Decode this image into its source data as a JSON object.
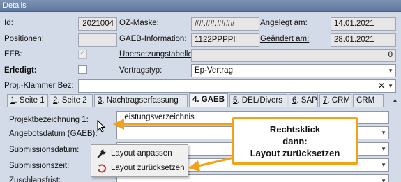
{
  "window": {
    "title": "Details"
  },
  "fields": {
    "id": {
      "label": "Id:",
      "value": "2021004"
    },
    "oz_maske": {
      "label": "OZ-Maske:",
      "value": "##.##.####"
    },
    "angelegt": {
      "label": "Angelegt am:",
      "value": "14.01.2021"
    },
    "positionen": {
      "label": "Positionen:",
      "value": ""
    },
    "gaeb_info": {
      "label": "GAEB-Information:",
      "value": "1122PPPPI"
    },
    "geaendert": {
      "label": "Geändert am:",
      "value": "28.01.2021"
    },
    "efb": {
      "label": "EFB:"
    },
    "uebersetzung": {
      "label": "Übersetzungstabelle",
      "value": "0"
    },
    "erledigt": {
      "label": "Erledigt:"
    },
    "vertragstyp": {
      "label": "Vertragstyp:",
      "value": "Ep-Vertrag"
    },
    "proj_klammer": {
      "label": "Proj.-Klammer Bez:",
      "value": ""
    }
  },
  "tabs": [
    {
      "num": "1",
      "label": ". Seite 1"
    },
    {
      "num": "2",
      "label": ". Seite 2"
    },
    {
      "num": "3",
      "label": ". Nachtragserfassung"
    },
    {
      "num": "4",
      "label": ". GAEB"
    },
    {
      "num": "5",
      "label": ". DEL/Divers"
    },
    {
      "num": "6",
      "label": ". SAP"
    },
    {
      "num": "7",
      "label": ". CRM"
    },
    {
      "num": "",
      "label": "CRM"
    }
  ],
  "gaeb_panel": {
    "projektbezeichnung": {
      "label": "Projektbezeichnung 1:",
      "value": "Leistungsverzeichnis"
    },
    "angebotsdatum": {
      "label": "Angebotsdatum (GAEB):"
    },
    "submissionsdatum": {
      "label": "Submissionsdatum:"
    },
    "submissionszeit": {
      "label": "Submissionszeit:"
    },
    "zuschlagsfrist": {
      "label": "Zuschlagsfrist:"
    }
  },
  "context_menu": {
    "items": [
      {
        "label": "Layout anpassen",
        "icon": "wrench-icon"
      },
      {
        "label": "Layout zurücksetzen",
        "icon": "reset-icon"
      }
    ]
  },
  "callout": {
    "line1": "Rechtsklick",
    "line2": "dann:",
    "line3": "Layout zurücksetzen"
  },
  "colors": {
    "accent": "#f2a218",
    "header": "#5e789e",
    "panel": "#d4dbe8",
    "reset_icon": "#c0392b"
  }
}
